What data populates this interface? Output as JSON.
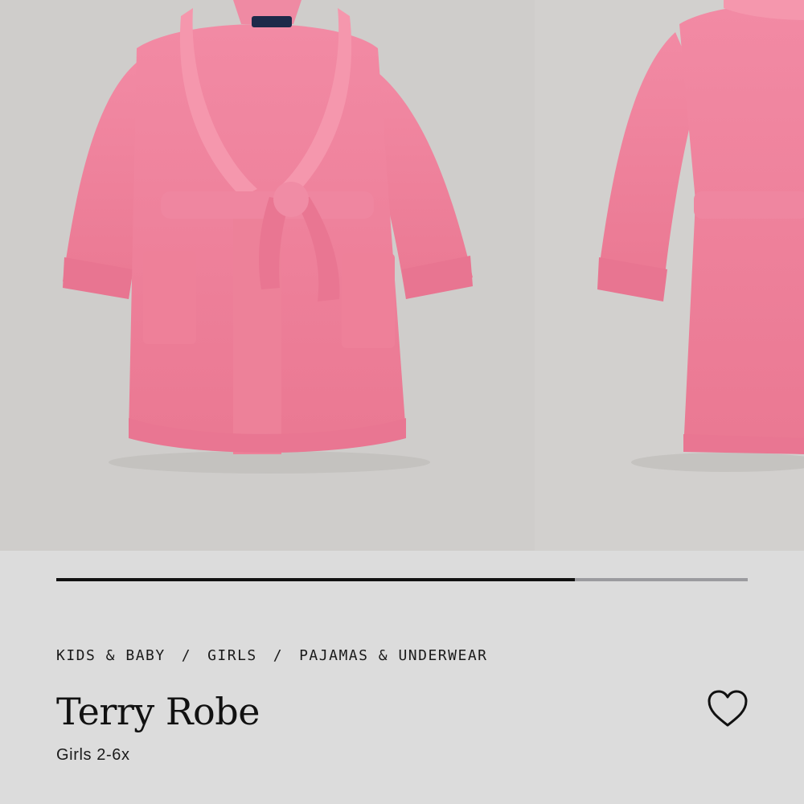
{
  "gallery": {
    "images": [
      {
        "icon": "pink-robe-front-image"
      },
      {
        "icon": "pink-robe-side-image"
      }
    ],
    "progress": 0.75
  },
  "breadcrumb": {
    "items": [
      "KIDS & BABY",
      "GIRLS",
      "PAJAMAS & UNDERWEAR"
    ],
    "separator": "/"
  },
  "product": {
    "title": "Terry Robe",
    "subtitle": "Girls 2-6x"
  },
  "wishlist": {
    "icon": "heart-icon"
  },
  "colors": {
    "robe": "#ee7e99",
    "background": "#dcdcdc",
    "progress_fill": "#111111",
    "progress_track": "#9b9b9f"
  }
}
